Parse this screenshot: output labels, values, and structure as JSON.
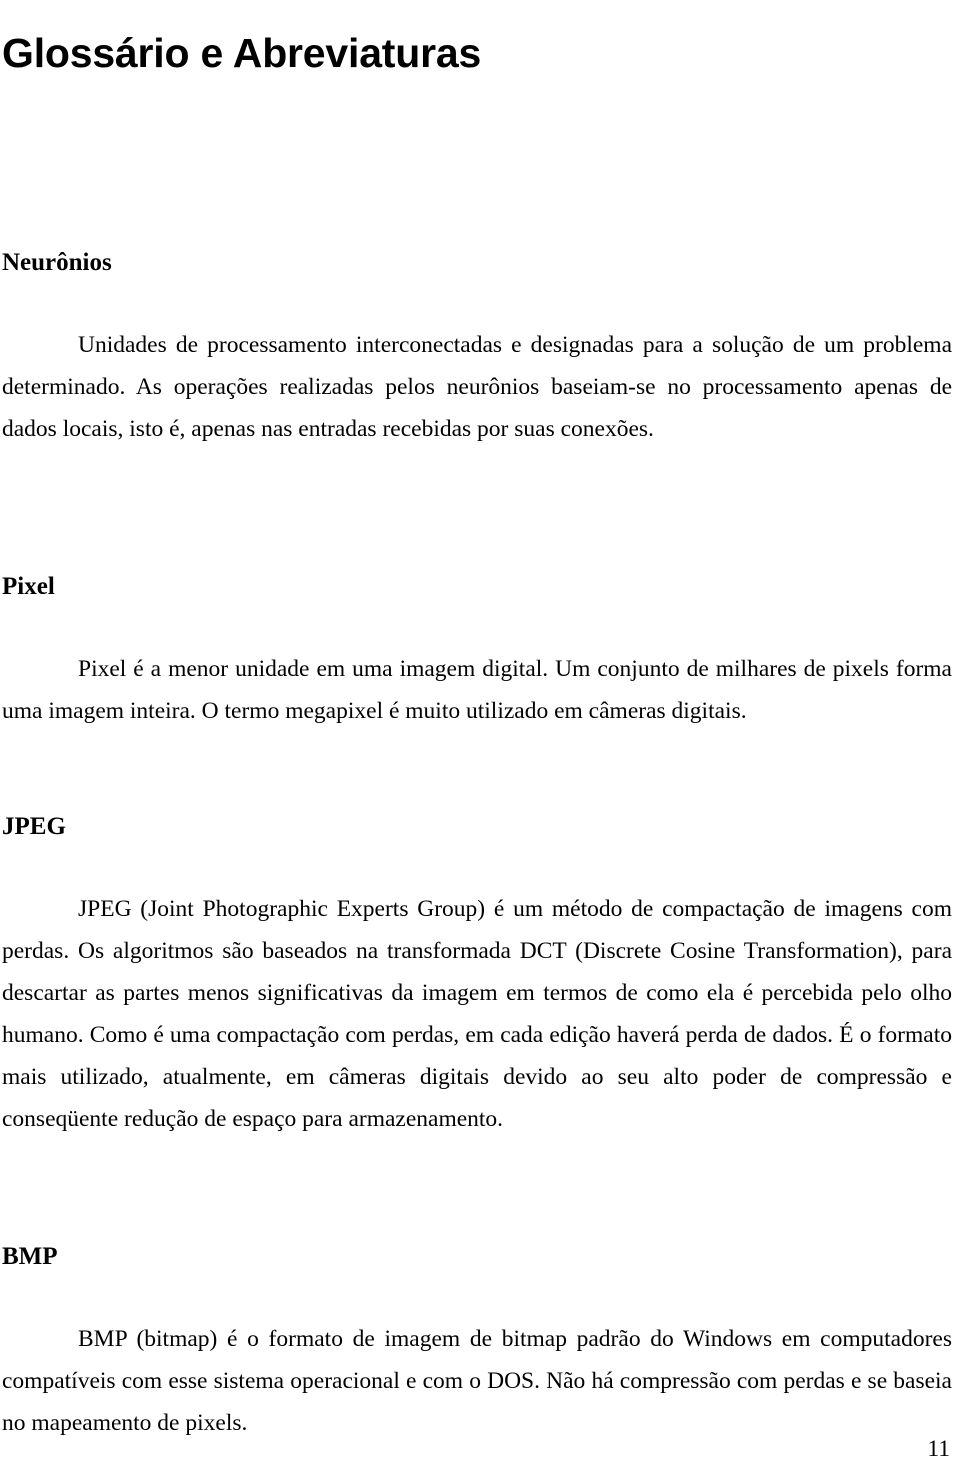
{
  "document": {
    "title": "Glossário e Abreviaturas",
    "page_number": "11",
    "sections": [
      {
        "heading": "Neurônios",
        "body": "Unidades de processamento interconectadas e designadas para a solução de um problema determinado. As operações realizadas pelos neurônios baseiam-se no processamento apenas de dados locais, isto é, apenas nas entradas recebidas por suas conexões."
      },
      {
        "heading": "Pixel",
        "body": "Pixel é a menor unidade em uma imagem digital. Um conjunto de milhares de pixels forma uma imagem inteira. O termo megapixel é muito utilizado em câmeras digitais."
      },
      {
        "heading": "JPEG",
        "body": "JPEG (Joint Photographic Experts Group) é um método de compactação de imagens com perdas. Os algoritmos são baseados na transformada DCT (Discrete Cosine Transformation), para descartar as partes menos significativas da imagem em termos de como ela é percebida pelo olho humano. Como é uma compactação com perdas, em cada edição haverá perda de dados. É o formato mais utilizado, atualmente, em câmeras digitais devido ao seu alto poder de compressão e conseqüente redução de espaço para armazenamento."
      },
      {
        "heading": "BMP",
        "body": "BMP (bitmap) é o formato de imagem de bitmap padrão do Windows em computadores compatíveis com esse sistema operacional e com o DOS. Não há compressão com perdas e se baseia no mapeamento de pixels."
      }
    ]
  }
}
